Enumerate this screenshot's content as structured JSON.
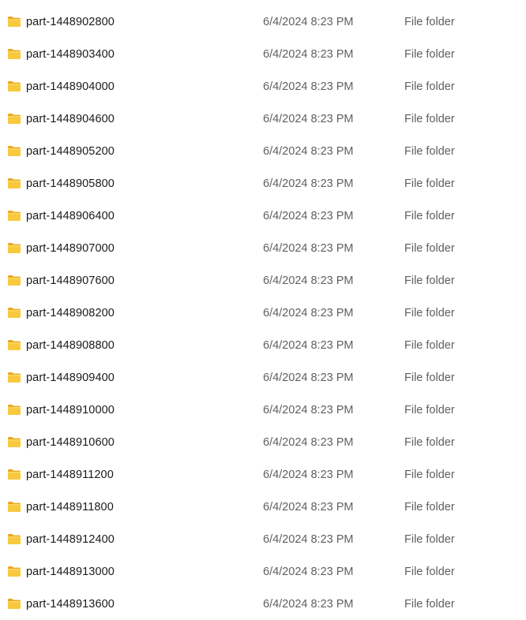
{
  "files": [
    {
      "name": "part-1448902800",
      "date_modified": "6/4/2024 8:23 PM",
      "type": "File folder",
      "icon": "folder-icon"
    },
    {
      "name": "part-1448903400",
      "date_modified": "6/4/2024 8:23 PM",
      "type": "File folder",
      "icon": "folder-icon"
    },
    {
      "name": "part-1448904000",
      "date_modified": "6/4/2024 8:23 PM",
      "type": "File folder",
      "icon": "folder-icon"
    },
    {
      "name": "part-1448904600",
      "date_modified": "6/4/2024 8:23 PM",
      "type": "File folder",
      "icon": "folder-icon"
    },
    {
      "name": "part-1448905200",
      "date_modified": "6/4/2024 8:23 PM",
      "type": "File folder",
      "icon": "folder-icon"
    },
    {
      "name": "part-1448905800",
      "date_modified": "6/4/2024 8:23 PM",
      "type": "File folder",
      "icon": "folder-icon"
    },
    {
      "name": "part-1448906400",
      "date_modified": "6/4/2024 8:23 PM",
      "type": "File folder",
      "icon": "folder-icon"
    },
    {
      "name": "part-1448907000",
      "date_modified": "6/4/2024 8:23 PM",
      "type": "File folder",
      "icon": "folder-icon"
    },
    {
      "name": "part-1448907600",
      "date_modified": "6/4/2024 8:23 PM",
      "type": "File folder",
      "icon": "folder-icon"
    },
    {
      "name": "part-1448908200",
      "date_modified": "6/4/2024 8:23 PM",
      "type": "File folder",
      "icon": "folder-icon"
    },
    {
      "name": "part-1448908800",
      "date_modified": "6/4/2024 8:23 PM",
      "type": "File folder",
      "icon": "folder-icon"
    },
    {
      "name": "part-1448909400",
      "date_modified": "6/4/2024 8:23 PM",
      "type": "File folder",
      "icon": "folder-icon"
    },
    {
      "name": "part-1448910000",
      "date_modified": "6/4/2024 8:23 PM",
      "type": "File folder",
      "icon": "folder-icon"
    },
    {
      "name": "part-1448910600",
      "date_modified": "6/4/2024 8:23 PM",
      "type": "File folder",
      "icon": "folder-icon"
    },
    {
      "name": "part-1448911200",
      "date_modified": "6/4/2024 8:23 PM",
      "type": "File folder",
      "icon": "folder-icon"
    },
    {
      "name": "part-1448911800",
      "date_modified": "6/4/2024 8:23 PM",
      "type": "File folder",
      "icon": "folder-icon"
    },
    {
      "name": "part-1448912400",
      "date_modified": "6/4/2024 8:23 PM",
      "type": "File folder",
      "icon": "folder-icon"
    },
    {
      "name": "part-1448913000",
      "date_modified": "6/4/2024 8:23 PM",
      "type": "File folder",
      "icon": "folder-icon"
    },
    {
      "name": "part-1448913600",
      "date_modified": "6/4/2024 8:23 PM",
      "type": "File folder",
      "icon": "folder-icon"
    }
  ],
  "colors": {
    "folder_body": "#f8c93d",
    "folder_tab": "#e9a920",
    "secondary_text": "#5f5f5f",
    "primary_text": "#1a1a1a"
  }
}
